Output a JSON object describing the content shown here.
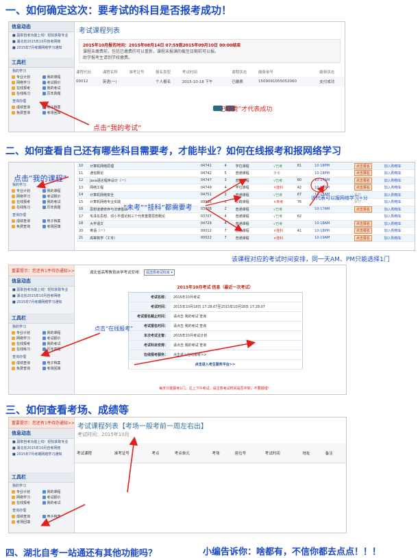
{
  "headings": {
    "h1": "一、如何确定这次：要考试的科目是否报考成功！",
    "h2": "二、如何查看自己还有哪些科目需要考，才能毕业？如何在线报考和报网络学习",
    "h3": "三、如何查看考场、成绩等",
    "h4": "四、湖北自考一站通还有其他功能吗？",
    "h4_tail": "小编告诉你：啥都有，不信你都去点点！！！"
  },
  "annotations": {
    "click_my_exam": "点击“我的考试”",
    "paid_success": "“已缴费”才代表成功",
    "click_my_course": "点击“我的课程”",
    "not_taken_failed": "“未考”“挂科”都需要考",
    "network_study": "该代表可以报网络学习+分",
    "exam_time_note": "该课程对应的考试时间安排，同一天AM、PM只能选择1门",
    "click_online_apply": "点击“在线报考”"
  },
  "sidebar": {
    "notice_title": "信息动态",
    "notice_lines": [
      "■ 副职自考功能上线！轻松获取专业",
      "■ 湖北省2015年10月自考网络",
      "■ 2015年7月考期网络学习通知"
    ],
    "toolbar_title": "工具栏",
    "study_title": "我的学习",
    "study_items": [
      "专业计划",
      "我的课程",
      "网络学习",
      "考试报价",
      "在线报考",
      "我的考试",
      "在线练习",
      "历年真题"
    ],
    "query_title": "查询办理",
    "query_items": [
      "成绩查询",
      "电子档案",
      "免费查询",
      "考场回填"
    ],
    "notice_bar": "重要提示：您还有1件待办通知>>"
  },
  "panel1": {
    "title": "考试课程列表",
    "info_bold": "2015年10月报名时间：2015年08月14日 07:59到2015年09月10日 00:00结束",
    "info_lines": [
      "课程未缴费前，包括已缴费的可以重新，课程未报满的截至日期前可以报。",
      "助学报考生请到学校缴费。"
    ],
    "headers": [
      "课程代码",
      "课程名称",
      "准考证号",
      "报名类型",
      "考试时间",
      "课程状态",
      "缴费单号",
      "缴费状态"
    ],
    "row": [
      "00012",
      "英语(一)",
      "",
      "个人报名",
      "2015-10-18 下午",
      "已缴费",
      "1509091055052060",
      "支付成功"
    ]
  },
  "panel2": {
    "rows": [
      [
        "10",
        "计算机网络原理",
        "04741",
        "4",
        "学位课程",
        "√已考",
        "61",
        "10-18PM",
        "点击报名",
        "加入购物车"
      ],
      [
        "11",
        "通信概论",
        "04742",
        "5",
        "普通课程",
        "未考",
        "",
        "10-18PM",
        "点击报名",
        "加入购物车"
      ],
      [
        "12",
        "Java语言程序设计（一）",
        "04747",
        "3",
        "普通课程",
        "√已考",
        "60",
        "10-17AM",
        "点击报名",
        "加入购物车"
      ],
      [
        "13",
        "网络工程",
        "04749",
        "4",
        "学位课程",
        "×挂科",
        "42",
        "10-17PM",
        "点击报名",
        "加入购物车"
      ],
      [
        "14",
        "计算机网络安全",
        "04751",
        "3",
        "普通课程",
        "√已考",
        "67",
        "10-18AM",
        "未付",
        "加入购物车"
      ],
      [
        "15",
        "计算机网络专业实践",
        "09916",
        "0",
        "实践课程",
        "×未考",
        "76",
        "",
        "未付",
        "加入购物车"
      ],
      [
        "16",
        "思想道德修养与法律基础",
        "03708",
        "2",
        "普通课程",
        "√已考",
        "",
        "10-17AM",
        "点击报名",
        "加入购物车"
      ],
      [
        "17",
        "毛泽东思想、邓小平理论和三个代表重要思想概论",
        "03707",
        "4",
        "普通课程",
        "√已考",
        "62",
        "",
        "",
        "加入购物车"
      ],
      [
        "18",
        "大学语文",
        "04729",
        "4",
        "普通课程",
        "√已考",
        "",
        "10-18AM",
        "点击报名",
        "加入购物车"
      ],
      [
        "20",
        "英语（一）",
        "00012",
        "7",
        "普通课程",
        "×挂科",
        "41",
        "10-18PM",
        "点击报名",
        "加入购物车"
      ],
      [
        "21",
        "高等数学（工专）",
        "00022",
        "7",
        "普通课程",
        "×挂科",
        "",
        "10-19AM",
        "点击报名",
        "加入购物车"
      ]
    ]
  },
  "panel3": {
    "top_label": "湖北省高等教育自学考试安排：",
    "top_select": "请选择考试科目",
    "exam_title": "2015年10月考试 信息（最近一次考试）",
    "fields": [
      {
        "k": "考试名称：",
        "v": "2015年10月考试"
      },
      {
        "k": "考试时间：",
        "v": "2015年10月18日 17:28:07至2015年10月18日 17:28:07"
      },
      {
        "k": "考试报名截止时间：",
        "v": "请点击 我的考试 查询"
      },
      {
        "k": "考试报名时间：",
        "v": "请点击 我的考试 查询"
      },
      {
        "k": "本次考试主管：",
        "v": "2015年10月考试计划"
      },
      {
        "k": "考试科目安排：",
        "v": "请点击 我的考试 查询"
      },
      {
        "k": "在线报考服务：",
        "v": "点击进入在线报考>>"
      }
    ],
    "go_label": "点击进入考生服务平台>>",
    "bottom_note": "每天只能报考1门，注上下午考试，请注意考试时间是否冲突，不要报错！"
  },
  "panel4": {
    "title": "考试课程列表【考场一般考前一周左右出】",
    "time": "考试时间：2015年10月",
    "headers": [
      "考试课程",
      "准考证号",
      "考点",
      "考点单元",
      "考场",
      "座位号",
      "考试时间",
      "地址",
      "备注"
    ]
  }
}
